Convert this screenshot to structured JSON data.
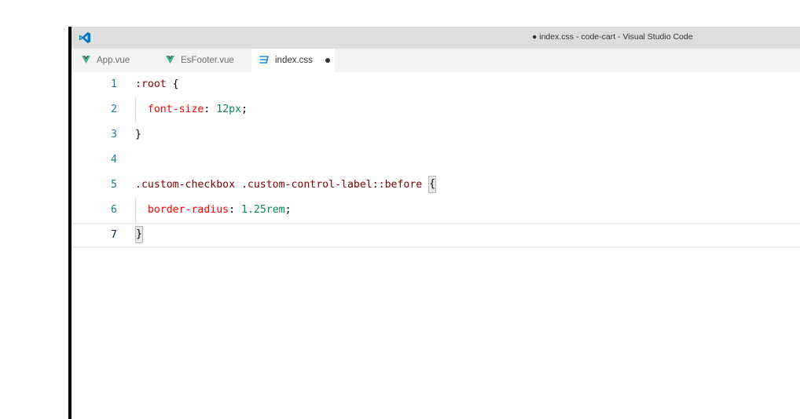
{
  "window": {
    "title": "● index.css - code-cart - Visual Studio Code",
    "logo_icon": "vscode-logo-icon",
    "accent_color": "#007acc"
  },
  "tabs": [
    {
      "label": "App.vue",
      "icon": "vue-icon",
      "icon_color": "#41b883",
      "active": false
    },
    {
      "label": "EsFooter.vue",
      "icon": "vue-icon",
      "icon_color": "#41b883",
      "active": false
    },
    {
      "label": "index.css",
      "icon": "css-icon",
      "icon_color": "#1e88e5",
      "active": true,
      "dirty": true
    }
  ],
  "editor": {
    "current_line": 7,
    "lines": [
      {
        "num": "1",
        "tokens": [
          {
            "t": ":root ",
            "c": "selector"
          },
          {
            "t": "{",
            "c": "punct"
          }
        ]
      },
      {
        "num": "2",
        "tokens": [
          {
            "t": "  ",
            "c": "punct"
          },
          {
            "t": "font-size",
            "c": "prop"
          },
          {
            "t": ": ",
            "c": "punct"
          },
          {
            "t": "12px",
            "c": "num"
          },
          {
            "t": ";",
            "c": "punct"
          }
        ]
      },
      {
        "num": "3",
        "tokens": [
          {
            "t": "}",
            "c": "punct"
          }
        ]
      },
      {
        "num": "4",
        "tokens": []
      },
      {
        "num": "5",
        "tokens": [
          {
            "t": ".custom-checkbox .custom-control-label::before ",
            "c": "selector"
          },
          {
            "t": "{",
            "c": "bracket"
          }
        ]
      },
      {
        "num": "6",
        "tokens": [
          {
            "t": "  ",
            "c": "punct"
          },
          {
            "t": "border-radius",
            "c": "prop"
          },
          {
            "t": ": ",
            "c": "punct"
          },
          {
            "t": "1.25rem",
            "c": "num"
          },
          {
            "t": ";",
            "c": "punct"
          }
        ]
      },
      {
        "num": "7",
        "tokens": [
          {
            "t": "}",
            "c": "bracket"
          }
        ]
      }
    ]
  }
}
